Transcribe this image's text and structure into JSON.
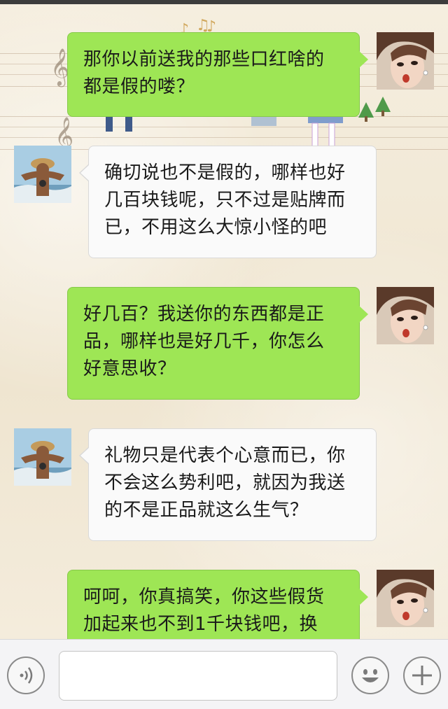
{
  "messages": [
    {
      "side": "sent",
      "lines": [
        "那你以前送我的那些口红啥的",
        "都是假的喽？"
      ]
    },
    {
      "side": "recv",
      "lines": [
        "确切说也不是假的，哪样也好",
        "几百块钱呢，只不过是贴牌而",
        "已，不用这么大惊小怪的吧"
      ]
    },
    {
      "side": "sent",
      "lines": [
        "好几百？我送你的东西都是正",
        "品，哪样也是好几千，你怎么",
        "好意思收？"
      ]
    },
    {
      "side": "recv",
      "lines": [
        "礼物只是代表个心意而已，你",
        "不会这么势利吧，就因为我送",
        "的不是正品就这么生气？"
      ]
    },
    {
      "side": "sent",
      "lines": [
        "呵呵，你真搞笑，你这些假货",
        "加起来也不到1千块钱吧，换"
      ]
    }
  ],
  "input_bar": {
    "text_value": "",
    "voice_icon": "voice-wave-icon",
    "emoji_icon": "smiley-face-icon",
    "more_icon": "plus-icon"
  },
  "colors": {
    "sent_bubble": "#9ee655",
    "recv_bubble": "#fafafa",
    "input_bar": "#f4f4f6"
  }
}
